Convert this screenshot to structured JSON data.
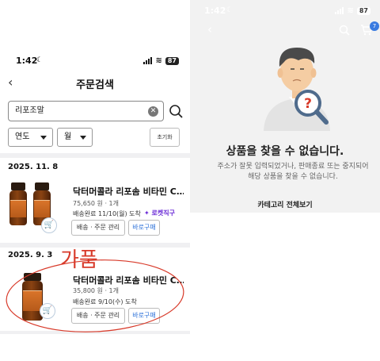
{
  "left": {
    "status": {
      "time": "1:42",
      "battery": "87"
    },
    "header": {
      "back_label": "‹",
      "title": "주문검색"
    },
    "search": {
      "value": "리포조말",
      "clear_label": "✕"
    },
    "filters": {
      "year": "연도",
      "month": "월",
      "reset": "초기화"
    },
    "orders": [
      {
        "date": "2025. 11. 8",
        "product": "닥터머콜라 리포솜 비타민 C…",
        "price": "75,650 원 · 1개",
        "delivery": "배송완료  11/10(월) 도착",
        "badge": "로켓직구",
        "btn_manage": "배송 · 주문 관리",
        "btn_rebuy": "바로구매"
      },
      {
        "date": "2025. 9. 3",
        "product": "닥터머콜라 리포솜 비타민 C…",
        "price": "35,800 원 · 1개",
        "delivery": "배송완료  9/10(수) 도착",
        "btn_manage": "배송 · 주문 관리",
        "btn_rebuy": "바로구매"
      }
    ],
    "annotation": "가품"
  },
  "right": {
    "status": {
      "time": "1:42",
      "battery": "87"
    },
    "cart_count": "7",
    "not_found_title": "상품을 찾을 수 없습니다.",
    "not_found_line1": "주소가 잘못 입력되었거나, 판매종료 또는 중지되어",
    "not_found_line2": "해당 상품을 찾을 수 없습니다.",
    "category_link": "카테고리 전체보기"
  },
  "colors": {
    "accent": "#3a7be0",
    "rocket": "#6a2bd6",
    "annotation": "#d83a2a"
  }
}
